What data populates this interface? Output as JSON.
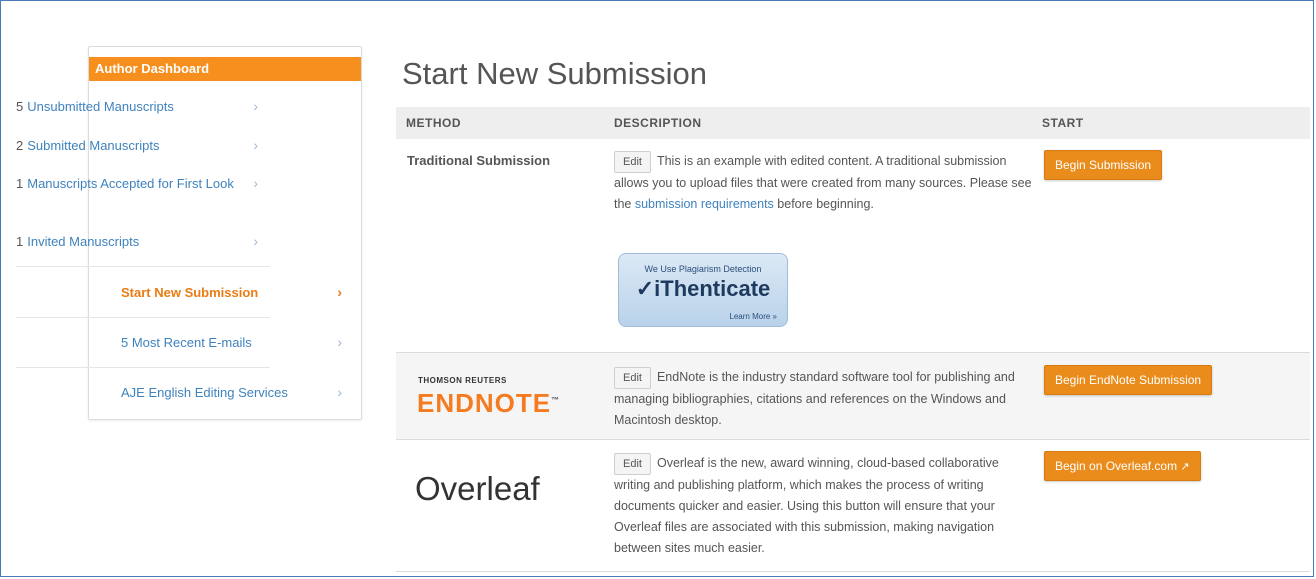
{
  "sidebar": {
    "header": "Author Dashboard",
    "items": [
      {
        "count": "5",
        "label": "Unsubmitted Manuscripts"
      },
      {
        "count": "2",
        "label": "Submitted Manuscripts"
      },
      {
        "count": "1",
        "label": "Manuscripts Accepted for First Look"
      },
      {
        "count": "1",
        "label": "Invited Manuscripts"
      },
      {
        "count": "",
        "label": "Start New Submission"
      },
      {
        "count": "",
        "label": "5 Most Recent E-mails"
      },
      {
        "count": "",
        "label": "AJE English Editing Services"
      }
    ]
  },
  "main": {
    "title": "Start New Submission",
    "columns": {
      "method": "METHOD",
      "description": "DESCRIPTION",
      "start": "START"
    },
    "edit_label": "Edit",
    "rows": [
      {
        "method": "Traditional Submission",
        "description_before": "This is an example with edited content. A traditional submission allows you to upload files that were created from many sources. Please see the ",
        "link": "submission requirements",
        "description_after": " before beginning.",
        "button": "Begin Submission",
        "badge": {
          "top": "We Use Plagiarism Detection",
          "brand": "iThenticate",
          "more": "Learn More »"
        }
      },
      {
        "logo_small": "THOMSON REUTERS",
        "logo_big": "ENDNOTE",
        "description": "EndNote is the industry standard software tool for publishing and managing bibliographies, citations and references on the Windows and Macintosh desktop.",
        "button": "Begin EndNote Submission"
      },
      {
        "logo": "Overleaf",
        "description": "Overleaf is the new, award winning, cloud-based collaborative writing and publishing platform, which makes the process of writing documents quicker and easier. Using this button will ensure that your Overleaf files are associated with this submission, making navigation between sites much easier.",
        "button": "Begin on Overleaf.com"
      }
    ]
  },
  "colors": {
    "accent": "#f78f1e",
    "button": "#ea8c1c",
    "link": "#3e82bd"
  }
}
